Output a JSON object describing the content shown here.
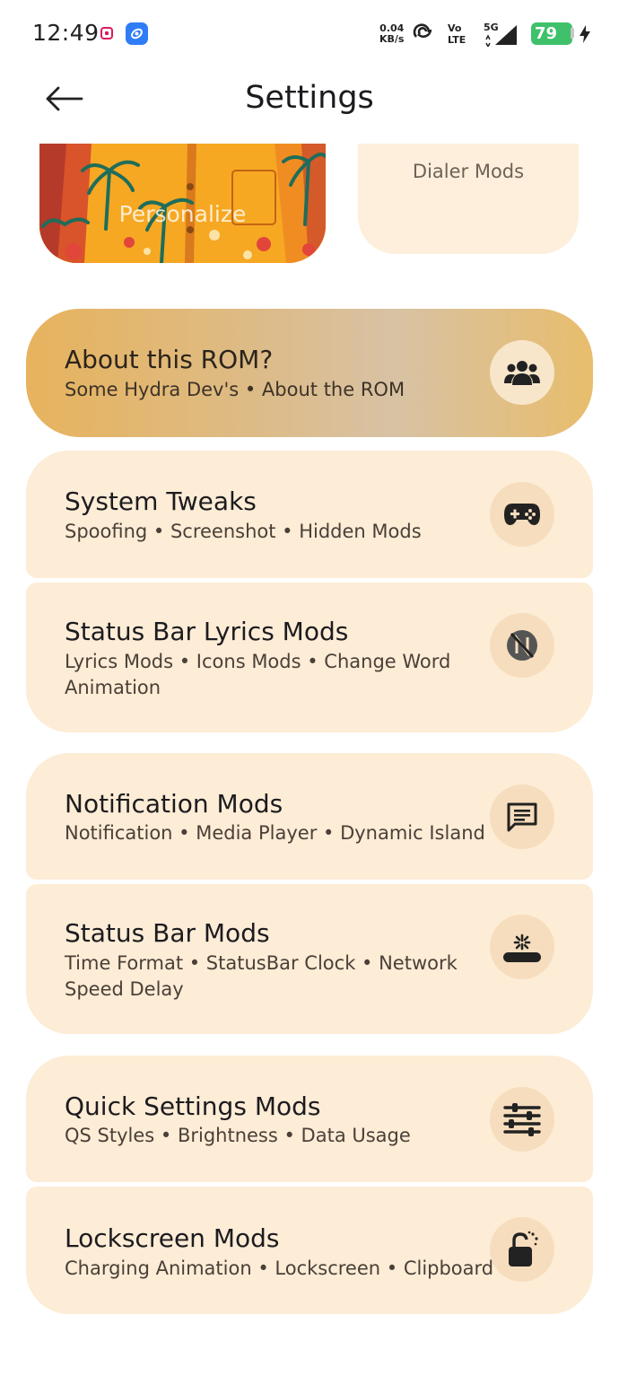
{
  "status_bar": {
    "time": "12:49",
    "net_speed_value": "0.04",
    "net_speed_unit": "KB/s",
    "volte_top": "Vo",
    "volte_bottom": "LTE",
    "network": "5G",
    "battery": "79",
    "icons": [
      "app-notification-icon",
      "browser-app-icon",
      "hotspot-icon",
      "volte-icon",
      "signal-icon",
      "battery-icon",
      "charging-icon"
    ]
  },
  "header": {
    "title": "Settings",
    "back_icon": "arrow-left-icon"
  },
  "top_cards": {
    "personalize": "Personalize",
    "dialer": "Dialer Mods"
  },
  "cards": [
    {
      "title": "About this ROM?",
      "subtitle": "Some Hydra Dev's  •  About the ROM",
      "icon": "group-icon"
    },
    {
      "title": "System Tweaks",
      "subtitle": "Spoofing  •  Screenshot  •  Hidden Mods",
      "icon": "gamepad-icon"
    },
    {
      "title": "Status Bar Lyrics Mods",
      "subtitle": "Lyrics Mods •  Icons Mods •  Change Word Animation",
      "icon": "music-off-icon"
    },
    {
      "title": "Notification Mods",
      "subtitle": "Notification  •  Media Player  •  Dynamic Island",
      "icon": "message-icon"
    },
    {
      "title": "Status Bar Mods",
      "subtitle": "Time Format  •  StatusBar Clock •  Network Speed Delay",
      "icon": "status-bar-icon"
    },
    {
      "title": "Quick Settings Mods",
      "subtitle": "QS Styles  •  Brightness  •  Data Usage",
      "icon": "sliders-icon"
    },
    {
      "title": "Lockscreen Mods",
      "subtitle": "Charging Animation •  Lockscreen  •  Clipboard",
      "icon": "lock-open-icon"
    }
  ],
  "colors": {
    "card_bg": "#fdecd6",
    "about_card_accent": "#e7b35d",
    "icon_circle": "#f6ddbd",
    "battery_green": "#3ec16a"
  }
}
